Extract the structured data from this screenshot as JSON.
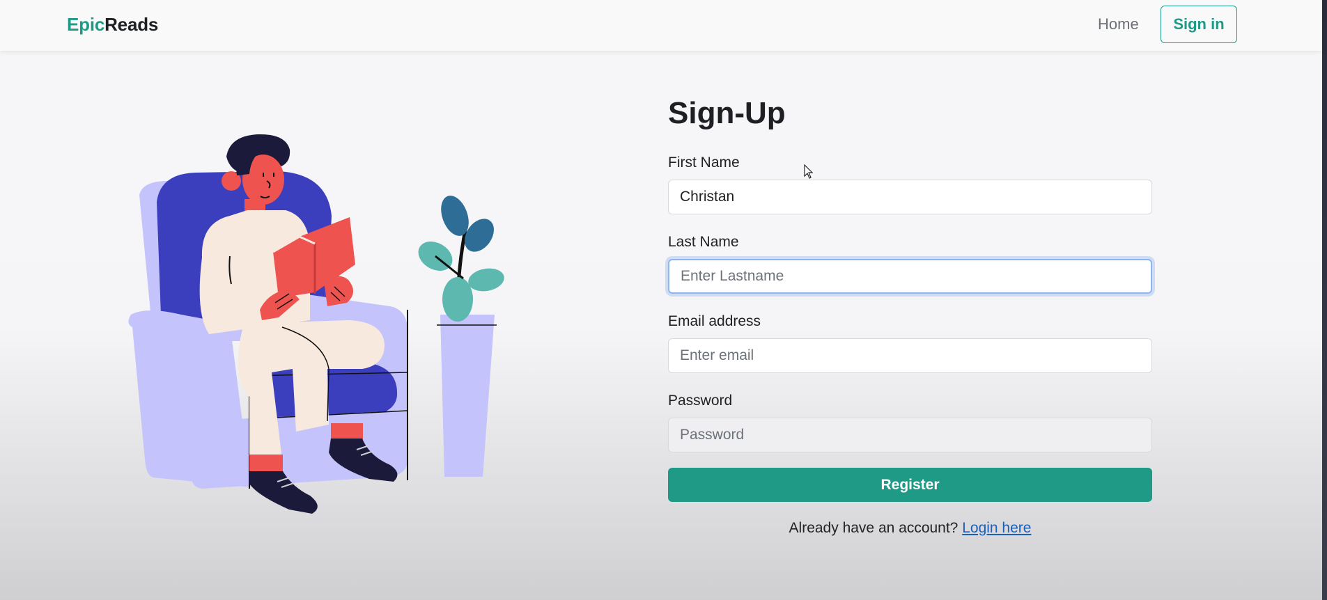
{
  "brand": {
    "part1": "Epic",
    "part2": "Reads"
  },
  "nav": {
    "home": "Home",
    "signin": "Sign in"
  },
  "form": {
    "title": "Sign-Up",
    "first_name": {
      "label": "First Name",
      "value": "Christan",
      "placeholder": ""
    },
    "last_name": {
      "label": "Last Name",
      "value": "",
      "placeholder": "Enter Lastname"
    },
    "email": {
      "label": "Email address",
      "value": "",
      "placeholder": "Enter email"
    },
    "password": {
      "label": "Password",
      "value": "",
      "placeholder": "Password"
    },
    "register": "Register",
    "login_prompt": "Already have an account?",
    "login_link": "Login here"
  },
  "colors": {
    "accent": "#1f9a86",
    "link": "#1b5fb8",
    "chair": "#3b3fbd",
    "chair_light": "#c4c3fb",
    "skin": "#ef5350",
    "shirt": "#f7e9dd",
    "plant": "#5db9b0"
  },
  "icons": [
    "mouse-cursor-icon"
  ]
}
